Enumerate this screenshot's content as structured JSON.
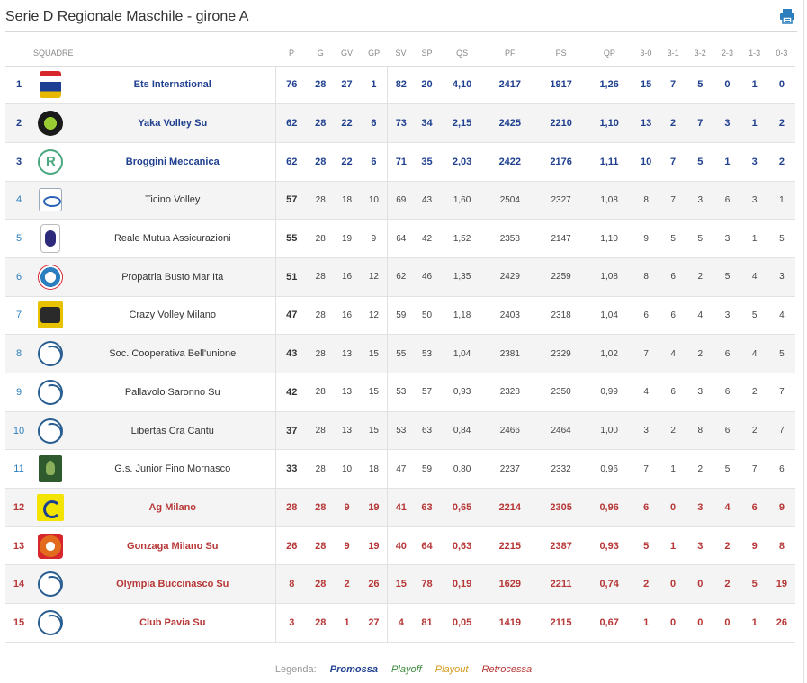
{
  "title": "Serie D Regionale Maschile - girone A",
  "icons": {
    "print": "print-icon"
  },
  "colors": {
    "promossa": "#1f3f8f",
    "playoff": "#3c8a3c",
    "playout": "#d49a1a",
    "retrocessa": "#b73737",
    "position": "#2c7fbe"
  },
  "columns": [
    "SQUADRE",
    "P",
    "G",
    "GV",
    "GP",
    "SV",
    "SP",
    "QS",
    "PF",
    "PS",
    "QP",
    "3-0",
    "3-1",
    "3-2",
    "2-3",
    "1-3",
    "0-3"
  ],
  "teams": [
    {
      "pos": "1",
      "logo": "ets",
      "name": "Ets International",
      "status": "promo",
      "p": "76",
      "g": "28",
      "gv": "27",
      "gp": "1",
      "sv": "82",
      "sp": "20",
      "qs": "4,10",
      "pf": "2417",
      "ps": "1917",
      "qp": "1,26",
      "r30": "15",
      "r31": "7",
      "r32": "5",
      "r23": "0",
      "r13": "1",
      "r03": "0"
    },
    {
      "pos": "2",
      "logo": "yaka",
      "name": "Yaka Volley Su",
      "status": "promo",
      "p": "62",
      "g": "28",
      "gv": "22",
      "gp": "6",
      "sv": "73",
      "sp": "34",
      "qs": "2,15",
      "pf": "2425",
      "ps": "2210",
      "qp": "1,10",
      "r30": "13",
      "r31": "2",
      "r32": "7",
      "r23": "3",
      "r13": "1",
      "r03": "2"
    },
    {
      "pos": "3",
      "logo": "brog",
      "name": "Broggini Meccanica",
      "status": "promo",
      "p": "62",
      "g": "28",
      "gv": "22",
      "gp": "6",
      "sv": "71",
      "sp": "35",
      "qs": "2,03",
      "pf": "2422",
      "ps": "2176",
      "qp": "1,11",
      "r30": "10",
      "r31": "7",
      "r32": "5",
      "r23": "1",
      "r13": "3",
      "r03": "2"
    },
    {
      "pos": "4",
      "logo": "ticino",
      "name": "Ticino Volley",
      "status": "normal",
      "p": "57",
      "g": "28",
      "gv": "18",
      "gp": "10",
      "sv": "69",
      "sp": "43",
      "qs": "1,60",
      "pf": "2504",
      "ps": "2327",
      "qp": "1,08",
      "r30": "8",
      "r31": "7",
      "r32": "3",
      "r23": "6",
      "r13": "3",
      "r03": "1"
    },
    {
      "pos": "5",
      "logo": "reale",
      "name": "Reale Mutua Assicurazioni",
      "status": "normal",
      "p": "55",
      "g": "28",
      "gv": "19",
      "gp": "9",
      "sv": "64",
      "sp": "42",
      "qs": "1,52",
      "pf": "2358",
      "ps": "2147",
      "qp": "1,10",
      "r30": "9",
      "r31": "5",
      "r32": "5",
      "r23": "3",
      "r13": "1",
      "r03": "5"
    },
    {
      "pos": "6",
      "logo": "prop",
      "name": "Propatria Busto Mar Ita",
      "status": "normal",
      "p": "51",
      "g": "28",
      "gv": "16",
      "gp": "12",
      "sv": "62",
      "sp": "46",
      "qs": "1,35",
      "pf": "2429",
      "ps": "2259",
      "qp": "1,08",
      "r30": "8",
      "r31": "6",
      "r32": "2",
      "r23": "5",
      "r13": "4",
      "r03": "3"
    },
    {
      "pos": "7",
      "logo": "crazy",
      "name": "Crazy Volley Milano",
      "status": "normal",
      "p": "47",
      "g": "28",
      "gv": "16",
      "gp": "12",
      "sv": "59",
      "sp": "50",
      "qs": "1,18",
      "pf": "2403",
      "ps": "2318",
      "qp": "1,04",
      "r30": "6",
      "r31": "6",
      "r32": "4",
      "r23": "3",
      "r13": "5",
      "r03": "4"
    },
    {
      "pos": "8",
      "logo": "ball",
      "name": "Soc. Cooperativa Bell'unione",
      "status": "normal",
      "p": "43",
      "g": "28",
      "gv": "13",
      "gp": "15",
      "sv": "55",
      "sp": "53",
      "qs": "1,04",
      "pf": "2381",
      "ps": "2329",
      "qp": "1,02",
      "r30": "7",
      "r31": "4",
      "r32": "2",
      "r23": "6",
      "r13": "4",
      "r03": "5"
    },
    {
      "pos": "9",
      "logo": "ball",
      "name": "Pallavolo Saronno Su",
      "status": "normal",
      "p": "42",
      "g": "28",
      "gv": "13",
      "gp": "15",
      "sv": "53",
      "sp": "57",
      "qs": "0,93",
      "pf": "2328",
      "ps": "2350",
      "qp": "0,99",
      "r30": "4",
      "r31": "6",
      "r32": "3",
      "r23": "6",
      "r13": "2",
      "r03": "7"
    },
    {
      "pos": "10",
      "logo": "ball",
      "name": "Libertas Cra Cantu",
      "status": "normal",
      "p": "37",
      "g": "28",
      "gv": "13",
      "gp": "15",
      "sv": "53",
      "sp": "63",
      "qs": "0,84",
      "pf": "2466",
      "ps": "2464",
      "qp": "1,00",
      "r30": "3",
      "r31": "2",
      "r32": "8",
      "r23": "6",
      "r13": "2",
      "r03": "7"
    },
    {
      "pos": "11",
      "logo": "gs",
      "name": "G.s. Junior Fino Mornasco",
      "status": "normal",
      "p": "33",
      "g": "28",
      "gv": "10",
      "gp": "18",
      "sv": "47",
      "sp": "59",
      "qs": "0,80",
      "pf": "2237",
      "ps": "2332",
      "qp": "0,96",
      "r30": "7",
      "r31": "1",
      "r32": "2",
      "r23": "5",
      "r13": "7",
      "r03": "6"
    },
    {
      "pos": "12",
      "logo": "ag",
      "name": "Ag Milano",
      "status": "relegb",
      "p": "28",
      "g": "28",
      "gv": "9",
      "gp": "19",
      "sv": "41",
      "sp": "63",
      "qs": "0,65",
      "pf": "2214",
      "ps": "2305",
      "qp": "0,96",
      "r30": "6",
      "r31": "0",
      "r32": "3",
      "r23": "4",
      "r13": "6",
      "r03": "9"
    },
    {
      "pos": "13",
      "logo": "gonz",
      "name": "Gonzaga Milano Su",
      "status": "relegb",
      "p": "26",
      "g": "28",
      "gv": "9",
      "gp": "19",
      "sv": "40",
      "sp": "64",
      "qs": "0,63",
      "pf": "2215",
      "ps": "2387",
      "qp": "0,93",
      "r30": "5",
      "r31": "1",
      "r32": "3",
      "r23": "2",
      "r13": "9",
      "r03": "8"
    },
    {
      "pos": "14",
      "logo": "ball",
      "name": "Olympia Buccinasco Su",
      "status": "relegb",
      "p": "8",
      "g": "28",
      "gv": "2",
      "gp": "26",
      "sv": "15",
      "sp": "78",
      "qs": "0,19",
      "pf": "1629",
      "ps": "2211",
      "qp": "0,74",
      "r30": "2",
      "r31": "0",
      "r32": "0",
      "r23": "2",
      "r13": "5",
      "r03": "19"
    },
    {
      "pos": "15",
      "logo": "ball",
      "name": "Club Pavia Su",
      "status": "relegb",
      "p": "3",
      "g": "28",
      "gv": "1",
      "gp": "27",
      "sv": "4",
      "sp": "81",
      "qs": "0,05",
      "pf": "1419",
      "ps": "2115",
      "qp": "0,67",
      "r30": "1",
      "r31": "0",
      "r32": "0",
      "r23": "0",
      "r13": "1",
      "r03": "26"
    }
  ],
  "legend": {
    "label": "Legenda:",
    "promossa": "Promossa",
    "playoff": "Playoff",
    "playout": "Playout",
    "retrocessa": "Retrocessa"
  }
}
